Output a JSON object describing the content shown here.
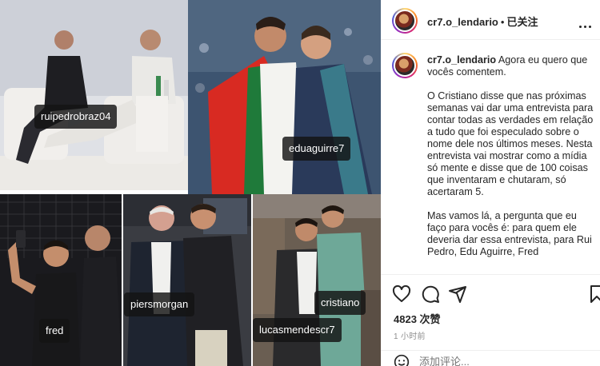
{
  "post": {
    "username": "cr7.o_lendario",
    "separator": "•",
    "follow_status": "已关注",
    "caption_lead": "Agora eu quero que vocês comentem.",
    "caption_p2": "O Cristiano disse que nas próximas semanas vai dar uma entrevista para contar todas as verdades em relação a tudo que foi especulado sobre o nome dele nos últimos meses. Nesta entrevista vai mostrar como a mídia só mente e disse que de 100 coisas que inventaram e chutaram, só acertaram 5.",
    "caption_p3": "Mas vamos lá, a pergunta que eu faço para vocês é: para quem ele deveria dar essa entrevista, para Rui Pedro, Edu Aguirre, Fred",
    "likes": "4823 次赞",
    "time": "1 小时前",
    "comment_placeholder": "添加评论..."
  },
  "photo_tags": [
    "ruipedrobraz04",
    "eduaguirre7",
    "fred",
    "piersmorgan",
    "cristiano",
    "lucasmendescr7"
  ],
  "icons": [
    "heart-icon",
    "comment-icon",
    "share-icon",
    "bookmark-icon",
    "more-icon",
    "emoji-icon"
  ],
  "colors": {
    "text": "#262626",
    "muted": "#8e8e8e",
    "border": "#efefef"
  }
}
